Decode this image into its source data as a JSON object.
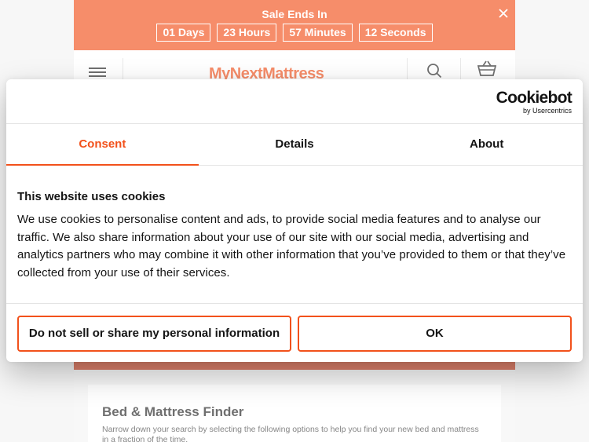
{
  "sale_banner": {
    "title": "Sale Ends In",
    "timer": [
      "01 Days",
      "23 Hours",
      "57 Minutes",
      "12 Seconds"
    ],
    "close_icon": "close-icon"
  },
  "header": {
    "logo": "MyNextMattress",
    "icons": [
      "menu-icon",
      "search-icon",
      "basket-icon"
    ]
  },
  "finder": {
    "title": "Bed & Mattress Finder",
    "text": "Narrow down your search by selecting the following options to help you find your new bed and mattress in a fraction of the time."
  },
  "cookie_dialog": {
    "brand": "Cookiebot",
    "brand_sub": "by Usercentrics",
    "tabs": [
      "Consent",
      "Details",
      "About"
    ],
    "active_tab": "Consent",
    "title": "This website uses cookies",
    "text": "We use cookies to personalise content and ads, to provide social media features and to analyse our traffic. We also share information about your use of our site with our social media, advertising and analytics partners who may combine it with other information that you’ve provided to them or that they’ve collected from your use of their services.",
    "buttons": {
      "do_not_sell": "Do not sell or share my personal information",
      "ok": "OK"
    }
  },
  "colors": {
    "accent": "#f2511b",
    "dark_strip": "#c93b1c",
    "text": "#141414"
  }
}
